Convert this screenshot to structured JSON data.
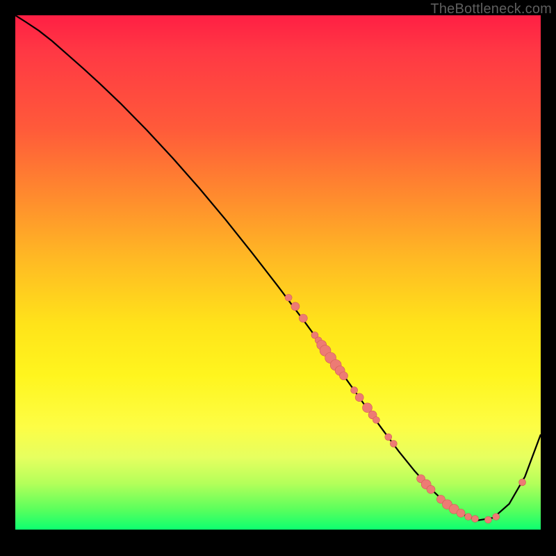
{
  "attribution": {
    "label": "TheBottleneck.com",
    "url_visible": false
  },
  "colors": {
    "background": "#000000",
    "gradient_stops": [
      "#ff1f44",
      "#ff5a3a",
      "#ffb824",
      "#fff51e",
      "#5cff5c",
      "#0dff70"
    ],
    "curve": "#000000",
    "point_fill": "#ed7b74",
    "point_stroke": "#d15b55",
    "attribution_text": "#5f5f5f"
  },
  "chart_data": {
    "type": "line",
    "title": "",
    "xlabel": "",
    "ylabel": "",
    "xlim": [
      0,
      100
    ],
    "ylim": [
      0,
      100
    ],
    "grid": false,
    "_comment": "Axes are unlabeled in the image. Values below are normalized to 0–100 across the visible chart area, estimated off the figure. y is measured as height above the bottom of the coloured area (bottom=0, top=100).",
    "series": [
      {
        "name": "bottleneck-curve",
        "x": [
          0.0,
          2.0,
          4.5,
          7.0,
          10.0,
          13.0,
          16.0,
          20.0,
          25.0,
          30.0,
          35.0,
          40.0,
          45.0,
          50.0,
          55.0,
          58.0,
          61.0,
          64.0,
          67.0,
          70.0,
          73.0,
          76.0,
          79.0,
          82.0,
          85.0,
          88.0,
          91.0,
          94.0,
          97.0,
          100.0
        ],
        "y": [
          100.0,
          98.7,
          97.0,
          95.0,
          92.3,
          89.6,
          86.8,
          82.9,
          77.7,
          72.2,
          66.4,
          60.3,
          53.9,
          47.3,
          40.5,
          36.3,
          32.1,
          27.8,
          23.5,
          19.3,
          15.2,
          11.4,
          8.0,
          5.1,
          3.0,
          1.8,
          2.3,
          5.0,
          10.3,
          18.5
        ]
      }
    ],
    "points": {
      "name": "highlighted-points",
      "_comment": "Same coordinate system. Size ~ relative marker radius.",
      "data": [
        {
          "x": 52.0,
          "y": 45.1,
          "size": 5
        },
        {
          "x": 53.3,
          "y": 43.4,
          "size": 6
        },
        {
          "x": 54.8,
          "y": 41.1,
          "size": 6
        },
        {
          "x": 57.0,
          "y": 37.8,
          "size": 5
        },
        {
          "x": 57.7,
          "y": 36.8,
          "size": 5
        },
        {
          "x": 58.3,
          "y": 35.9,
          "size": 7
        },
        {
          "x": 59.0,
          "y": 34.8,
          "size": 8
        },
        {
          "x": 60.0,
          "y": 33.4,
          "size": 8
        },
        {
          "x": 61.0,
          "y": 32.0,
          "size": 8
        },
        {
          "x": 61.8,
          "y": 30.9,
          "size": 7
        },
        {
          "x": 62.5,
          "y": 29.9,
          "size": 6
        },
        {
          "x": 64.5,
          "y": 27.1,
          "size": 5
        },
        {
          "x": 65.5,
          "y": 25.7,
          "size": 6
        },
        {
          "x": 67.0,
          "y": 23.7,
          "size": 7
        },
        {
          "x": 68.0,
          "y": 22.3,
          "size": 6
        },
        {
          "x": 68.7,
          "y": 21.3,
          "size": 5
        },
        {
          "x": 71.0,
          "y": 18.0,
          "size": 5
        },
        {
          "x": 72.0,
          "y": 16.7,
          "size": 5
        },
        {
          "x": 77.2,
          "y": 9.9,
          "size": 6
        },
        {
          "x": 78.2,
          "y": 8.8,
          "size": 7
        },
        {
          "x": 79.1,
          "y": 7.8,
          "size": 6
        },
        {
          "x": 81.0,
          "y": 5.9,
          "size": 6
        },
        {
          "x": 82.2,
          "y": 4.9,
          "size": 7
        },
        {
          "x": 83.5,
          "y": 4.0,
          "size": 7
        },
        {
          "x": 84.8,
          "y": 3.2,
          "size": 6
        },
        {
          "x": 86.2,
          "y": 2.5,
          "size": 5
        },
        {
          "x": 87.5,
          "y": 2.1,
          "size": 5
        },
        {
          "x": 90.0,
          "y": 1.9,
          "size": 5
        },
        {
          "x": 91.5,
          "y": 2.5,
          "size": 5
        },
        {
          "x": 96.5,
          "y": 9.2,
          "size": 5
        }
      ]
    }
  }
}
